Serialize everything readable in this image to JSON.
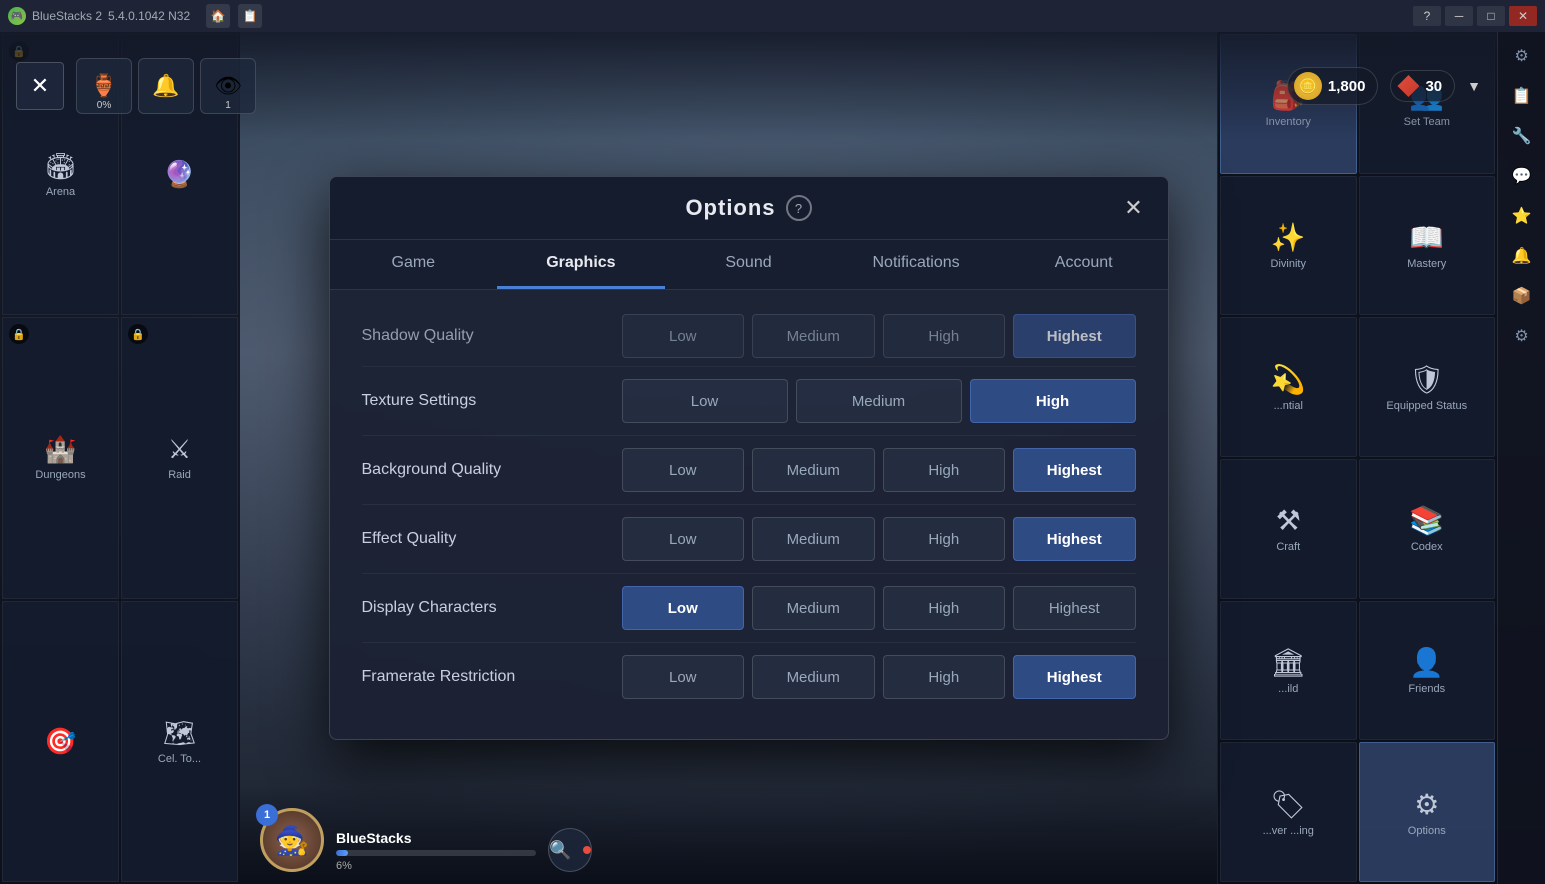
{
  "titleBar": {
    "appName": "BlueStacks 2",
    "version": "5.4.0.1042 N32",
    "controls": [
      "?",
      "─",
      "□",
      "✕"
    ]
  },
  "topBar": {
    "closeLabel": "✕",
    "icons": [
      {
        "label": "0%",
        "icon": "🏺"
      },
      {
        "label": "",
        "icon": "🔔"
      },
      {
        "label": "1",
        "icon": "👁"
      }
    ],
    "resources": [
      {
        "value": "1,800",
        "type": "coin"
      },
      {
        "value": "30",
        "type": "gem"
      }
    ]
  },
  "rightSidebar": {
    "icons": [
      "⚙",
      "📋",
      "🔧",
      "💬",
      "⭐",
      "🔔",
      "📦",
      "⚙"
    ]
  },
  "gameMenu": {
    "cells": [
      {
        "label": "Inventory",
        "icon": "🎒",
        "locked": false,
        "active": true
      },
      {
        "label": "Set Team",
        "icon": "👥",
        "locked": false,
        "active": false
      },
      {
        "label": "Divinity",
        "icon": "✨",
        "locked": false,
        "active": false
      },
      {
        "label": "Mastery",
        "icon": "📖",
        "locked": false,
        "active": false
      },
      {
        "label": "Equipped Status",
        "icon": "🛡",
        "locked": false,
        "active": false
      },
      {
        "label": "",
        "icon": "",
        "locked": false,
        "active": false
      },
      {
        "label": "Craft",
        "icon": "⚒",
        "locked": false,
        "active": false
      },
      {
        "label": "Codex",
        "icon": "📚",
        "locked": false,
        "active": false
      },
      {
        "label": "Friends",
        "icon": "👤",
        "locked": false,
        "active": false
      },
      {
        "label": "Equipped Status",
        "icon": "🛡",
        "locked": false,
        "active": false
      },
      {
        "label": "Options",
        "icon": "⚙",
        "locked": false,
        "active": false
      },
      {
        "label": "",
        "icon": "",
        "locked": false,
        "active": false
      }
    ]
  },
  "leftMenu": {
    "cells": [
      {
        "label": "Arena",
        "icon": "🏟",
        "locked": true
      },
      {
        "label": "",
        "icon": "🔮",
        "locked": false
      },
      {
        "label": "Dungeons",
        "icon": "🏰",
        "locked": true
      },
      {
        "label": "Raid",
        "icon": "⚔",
        "locked": true
      },
      {
        "label": "",
        "icon": "🎯",
        "locked": false
      },
      {
        "label": "To...",
        "icon": "🗺",
        "locked": false
      }
    ]
  },
  "player": {
    "name": "BlueStacks",
    "level": 1,
    "xpPercent": 6,
    "xpLabel": "6%"
  },
  "dialog": {
    "title": "Options",
    "helpIcon": "?",
    "closeIcon": "✕",
    "tabs": [
      {
        "label": "Game",
        "active": false
      },
      {
        "label": "Graphics",
        "active": true
      },
      {
        "label": "Sound",
        "active": false
      },
      {
        "label": "Notifications",
        "active": false
      },
      {
        "label": "Account",
        "active": false
      }
    ],
    "graphics": {
      "rows": [
        {
          "label": "Shadow Quality",
          "options": [
            "Low",
            "Medium",
            "High",
            "Highest"
          ],
          "selected": "Highest",
          "partial": true
        },
        {
          "label": "Texture Settings",
          "options": [
            "Low",
            "Medium",
            "High"
          ],
          "selected": "High",
          "partial": false
        },
        {
          "label": "Background Quality",
          "options": [
            "Low",
            "Medium",
            "High",
            "Highest"
          ],
          "selected": "Highest",
          "partial": false
        },
        {
          "label": "Effect Quality",
          "options": [
            "Low",
            "Medium",
            "High",
            "Highest"
          ],
          "selected": "Highest",
          "partial": false
        },
        {
          "label": "Display Characters",
          "options": [
            "Low",
            "Medium",
            "High",
            "Highest"
          ],
          "selected": "Low",
          "partial": false
        },
        {
          "label": "Framerate Restriction",
          "options": [
            "Low",
            "Medium",
            "High",
            "Highest"
          ],
          "selected": "Highest",
          "partial": false
        }
      ]
    }
  }
}
